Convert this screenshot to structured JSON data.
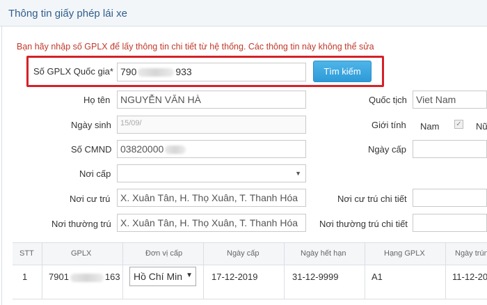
{
  "panel": {
    "title": "Thông tin giấy phép lái xe"
  },
  "notice": "Bạn hãy nhập số GPLX để lấy thông tin chi tiết từ hệ thống. Các thông tin này không thể sửa",
  "search": {
    "label": "Số GPLX Quốc gia*",
    "value_prefix": "790",
    "value_suffix": "933",
    "button": "Tìm kiếm"
  },
  "form": {
    "ho_ten": {
      "label": "Họ tên",
      "value": "NGUYỄN VĂN HÀ"
    },
    "quoc_tich": {
      "label": "Quốc tịch",
      "value": "Viet Nam"
    },
    "ngay_sinh": {
      "label": "Ngày sinh",
      "value": "15/09/"
    },
    "gioi_tinh": {
      "label": "Giới tính",
      "option_nam": "Nam",
      "option_nu": "Nữ"
    },
    "so_cmnd": {
      "label": "Số CMND",
      "value": "03820000"
    },
    "ngay_cap": {
      "label": "Ngày cấp",
      "value": ""
    },
    "noi_cap": {
      "label": "Nơi cấp",
      "value": ""
    },
    "noi_cu_tru": {
      "label": "Nơi cư trú",
      "value": "X. Xuân Tân, H. Thọ Xuân, T. Thanh Hóa"
    },
    "noi_cu_tru_chi_tiet": {
      "label": "Nơi cư trú chi tiết",
      "value": ""
    },
    "noi_thuong_tru": {
      "label": "Nơi thường trú",
      "value": "X. Xuân Tân, H. Thọ Xuân, T. Thanh Hóa"
    },
    "noi_thuong_tru_chi_tiet": {
      "label": "Nơi thường trú chi tiết",
      "value": ""
    }
  },
  "table": {
    "headers": [
      "STT",
      "GPLX",
      "Đơn vị cấp",
      "Ngày cấp",
      "Ngày hết hạn",
      "Hạng GPLX",
      "Ngày trúng"
    ],
    "rows": [
      {
        "stt": "1",
        "gplx_prefix": "7901",
        "gplx_suffix": "163",
        "don_vi_cap": "Hồ Chí Min",
        "ngay_cap": "17-12-2019",
        "ngay_het_han": "31-12-9999",
        "hang": "A1",
        "ngay_trung": "11-12-20"
      }
    ]
  }
}
